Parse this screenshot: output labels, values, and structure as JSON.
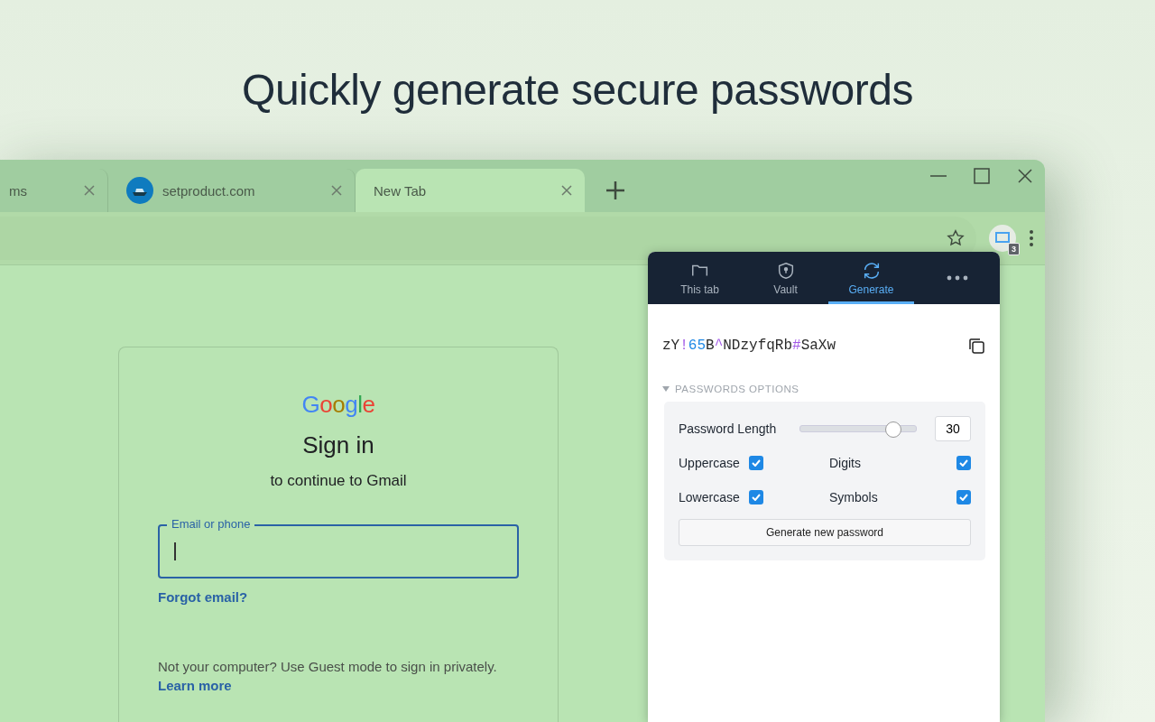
{
  "headline": "Quickly generate secure passwords",
  "browser": {
    "tabs": [
      {
        "label": "ms",
        "selected": false,
        "favicon": false
      },
      {
        "label": "setproduct.com",
        "selected": false,
        "favicon": true
      },
      {
        "label": "New Tab",
        "selected": true,
        "favicon": false
      }
    ],
    "extension_badge": "3"
  },
  "signin": {
    "logo": "Google",
    "title": "Sign in",
    "subtitle": "to continue to Gmail",
    "field_label": "Email or phone",
    "forgot": "Forgot email?",
    "note": "Not your computer? Use Guest mode to sign in privately.",
    "learn_more": "Learn more"
  },
  "popup": {
    "tabs": [
      {
        "label": "This tab",
        "kind": "folder",
        "selected": false
      },
      {
        "label": "Vault",
        "kind": "shield",
        "selected": false
      },
      {
        "label": "Generate",
        "kind": "refresh",
        "selected": true
      }
    ],
    "password": [
      {
        "text": "zY",
        "kind": "letter"
      },
      {
        "text": "!",
        "kind": "symbol"
      },
      {
        "text": "65",
        "kind": "digit"
      },
      {
        "text": "B",
        "kind": "letter"
      },
      {
        "text": "^",
        "kind": "symbol"
      },
      {
        "text": "NDzyfqRb",
        "kind": "letter"
      },
      {
        "text": "#",
        "kind": "symbol"
      },
      {
        "text": "SaXw",
        "kind": "letter"
      }
    ],
    "options_title": "PASSWORDS OPTIONS",
    "options_expanded": true,
    "length_label": "Password Length",
    "length": {
      "level": 0.8,
      "value": "30"
    },
    "options": [
      {
        "label": "Uppercase",
        "checked": true
      },
      {
        "label": "Digits",
        "checked": true
      },
      {
        "label": "Lowercase",
        "checked": true
      },
      {
        "label": "Symbols",
        "checked": true
      }
    ],
    "generate_button": "Generate new password"
  }
}
